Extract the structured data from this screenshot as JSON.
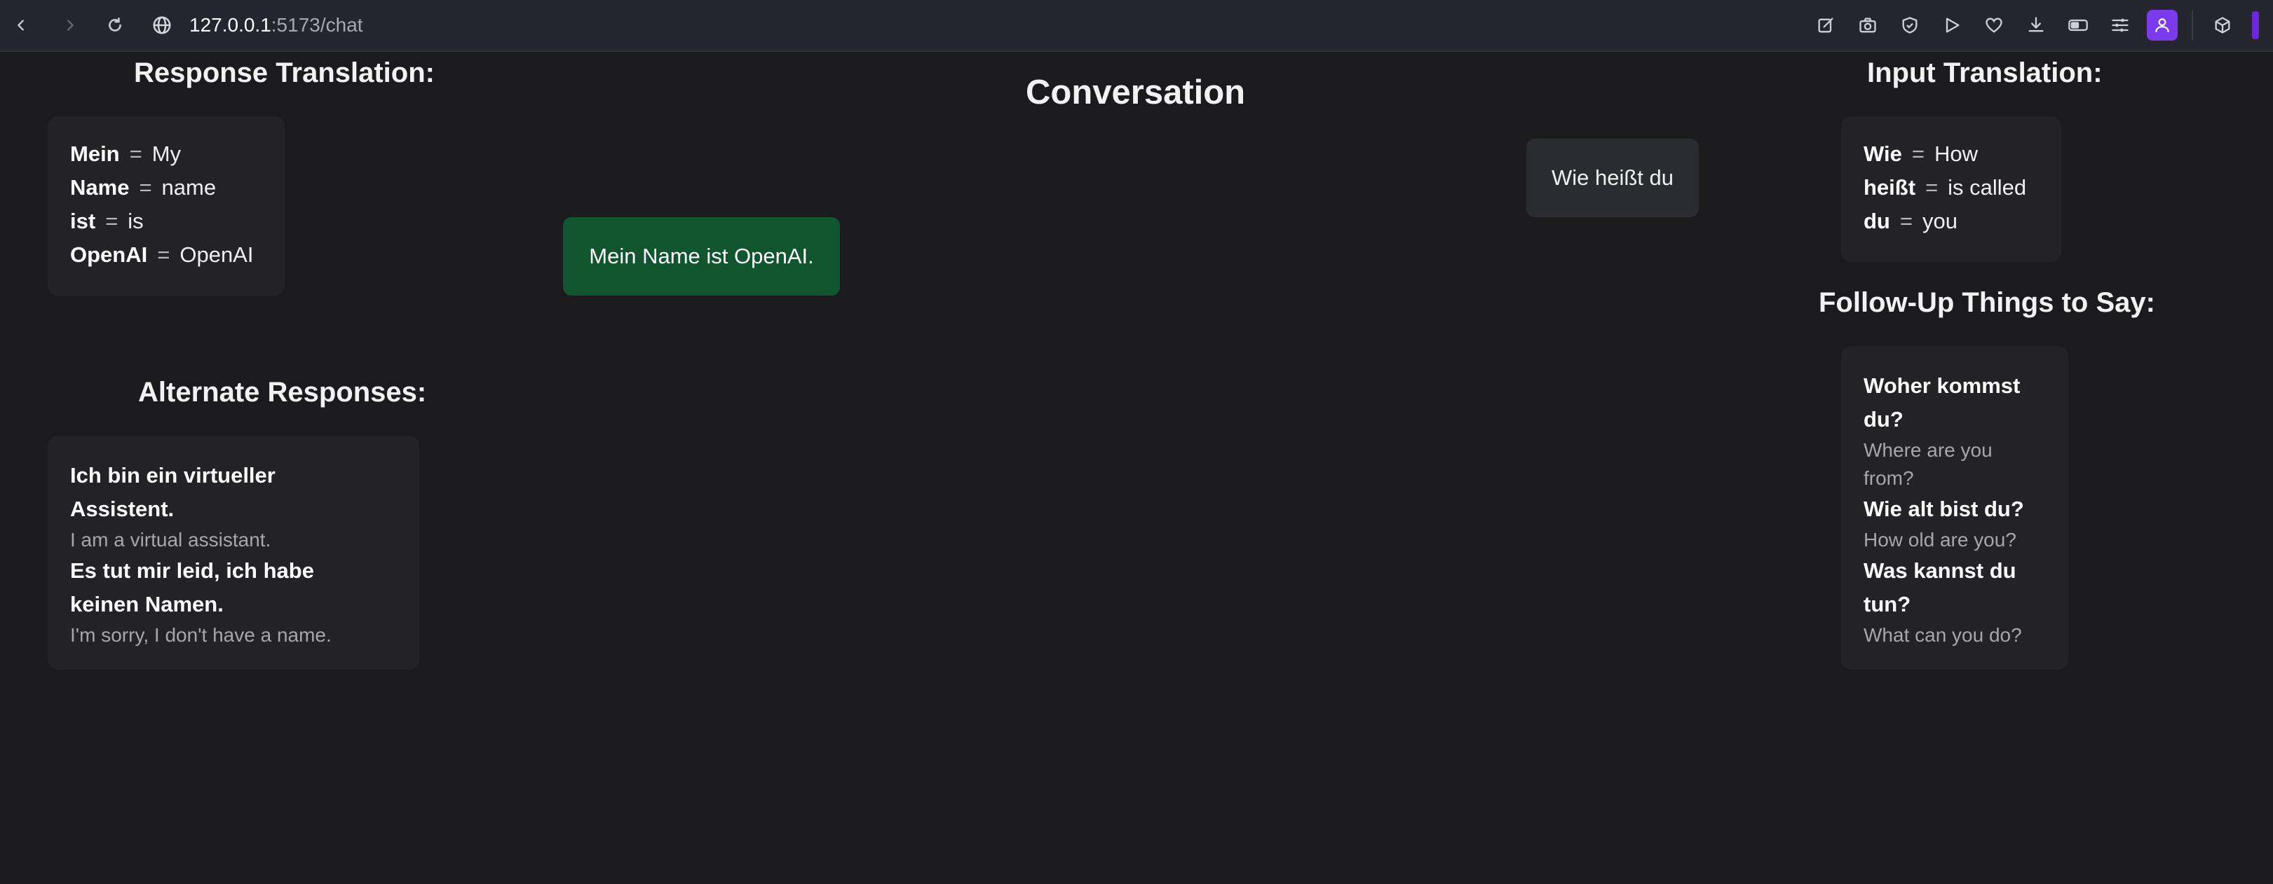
{
  "browser": {
    "url_host": "127.0.0.1",
    "url_rest": ":5173/chat",
    "toolbar_icons": [
      "edit-icon",
      "camera-icon",
      "shield-check-icon",
      "play-icon",
      "heart-icon",
      "download-icon",
      "toggle-icon",
      "sliders-icon",
      "profile-icon",
      "cube-icon"
    ]
  },
  "response_translation": {
    "heading": "Response Translation:",
    "separator": "=",
    "pairs": [
      {
        "de": "Mein",
        "en": "My"
      },
      {
        "de": "Name",
        "en": "name"
      },
      {
        "de": "ist",
        "en": "is"
      },
      {
        "de": "OpenAI",
        "en": "OpenAI"
      }
    ]
  },
  "alternate_responses": {
    "heading": "Alternate Responses:",
    "items": [
      {
        "de_lines": [
          "Ich bin ein virtueller",
          "Assistent."
        ],
        "en": "I am a virtual assistant."
      },
      {
        "de_lines": [
          "Es tut mir leid, ich habe",
          "keinen Namen."
        ],
        "en": "I'm sorry, I don't have a name."
      }
    ]
  },
  "conversation": {
    "heading": "Conversation",
    "messages": [
      {
        "role": "user",
        "text": "Wie heißt du"
      },
      {
        "role": "assistant",
        "text": "Mein Name ist OpenAI."
      }
    ]
  },
  "input_translation": {
    "heading": "Input Translation:",
    "separator": "=",
    "pairs": [
      {
        "de": "Wie",
        "en": "How"
      },
      {
        "de": "heißt",
        "en": "is called"
      },
      {
        "de": "du",
        "en": "you"
      }
    ]
  },
  "follow_up": {
    "heading": "Follow-Up Things to Say:",
    "items": [
      {
        "de_lines": [
          "Woher kommst",
          "du?"
        ],
        "en_lines": [
          "Where are you",
          "from?"
        ]
      },
      {
        "de_lines": [
          "Wie alt bist du?"
        ],
        "en_lines": [
          "How old are you?"
        ]
      },
      {
        "de_lines": [
          "Was kannst du",
          "tun?"
        ],
        "en_lines": [
          "What can you do?"
        ]
      }
    ]
  }
}
